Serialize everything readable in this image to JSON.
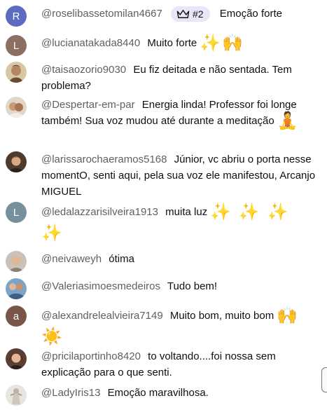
{
  "chat": {
    "messages": [
      {
        "author": "@roselibassetomilan4667",
        "avatar_letter": "R",
        "avatar_color": "#5c6bc0",
        "rank": "#2",
        "text": "Emoção forte",
        "emoji": ""
      },
      {
        "author": "@lucianatakada8440",
        "avatar_letter": "L",
        "avatar_color": "#8d6e63",
        "text": "Muito forte",
        "emoji": "✨🙌"
      },
      {
        "author": "@taisaozorio9030",
        "text": "Eu fiz deitada e não sentada. Tem problema?",
        "emoji": ""
      },
      {
        "author": "@Despertar-em-par",
        "text": "Energia linda! Professor foi longe também! Sua voz mudou até durante a meditação",
        "emoji": "🧘"
      },
      {
        "author": "@larissarochaeramos5168",
        "text": "Júnior, vc abriu o porta nesse momentO, senti aqui, pela sua voz ele manifestou, Arcanjo MIGUEL",
        "emoji": ""
      },
      {
        "author": "@ledalazzarisilveira1913",
        "avatar_letter": "L",
        "avatar_color": "#78909c",
        "text": "muita luz",
        "emoji": "✨ ✨ ✨ ✨"
      },
      {
        "author": "@neivaweyh",
        "text": "ótima",
        "emoji": ""
      },
      {
        "author": "@Valeriasimoesmedeiros",
        "text": "Tudo bem!",
        "emoji": ""
      },
      {
        "author": "@alexandrelealvieira7149",
        "avatar_letter": "a",
        "avatar_color": "#795548",
        "text": "Muito bom, muito bom",
        "emoji": "🙌 ☀️"
      },
      {
        "author": "@pricilaportinho8420",
        "text": "to voltando....foi nossa sem explicação para o que senti.",
        "emoji": ""
      },
      {
        "author": "@LadyIris13",
        "text": "Emoção maravilhosa.",
        "emoji": ""
      }
    ]
  },
  "colors": {
    "author": "#606060",
    "text": "#0f0f0f",
    "rank_badge_bg": "#e8e6f7"
  },
  "icons": {
    "rank": "crown-icon"
  }
}
